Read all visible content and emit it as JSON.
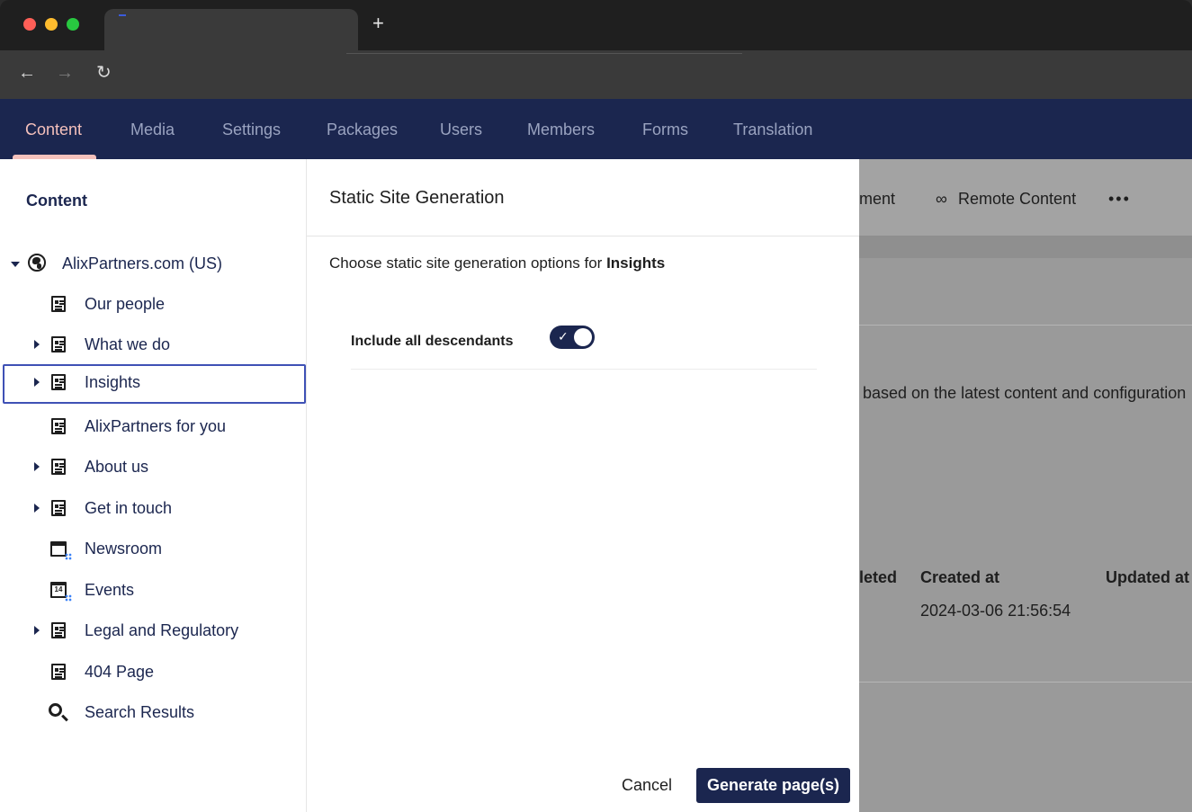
{
  "app": {
    "nav_tabs": [
      "Content",
      "Media",
      "Settings",
      "Packages",
      "Users",
      "Members",
      "Forms",
      "Translation"
    ],
    "active_tab": "Content"
  },
  "browser": {
    "new_tab": "+",
    "back": "←",
    "forward": "→",
    "reload": "↻"
  },
  "sidebar": {
    "title": "Content",
    "tree": [
      {
        "label": "AlixPartners.com (US)",
        "icon": "globe-icon",
        "expanded": true
      },
      {
        "label": "Our people",
        "icon": "document-icon"
      },
      {
        "label": "What we do",
        "icon": "document-icon",
        "has_children": true
      },
      {
        "label": "Insights",
        "icon": "document-icon",
        "has_children": true,
        "selected": true
      },
      {
        "label": "AlixPartners for you",
        "icon": "document-icon"
      },
      {
        "label": "About us",
        "icon": "document-icon",
        "has_children": true
      },
      {
        "label": "Get in touch",
        "icon": "document-icon",
        "has_children": true
      },
      {
        "label": "Newsroom",
        "icon": "newsroom-icon"
      },
      {
        "label": "Events",
        "icon": "calendar-icon",
        "calendar_day": "14"
      },
      {
        "label": "Legal and Regulatory",
        "icon": "document-icon",
        "has_children": true
      },
      {
        "label": "404 Page",
        "icon": "document-icon"
      },
      {
        "label": "Search Results",
        "icon": "search-icon"
      }
    ]
  },
  "background": {
    "tab_partial": "ment",
    "remote_content": "Remote Content",
    "infinity_symbol": "∞",
    "more": "•••",
    "description_partial": "based on the latest content and configuration",
    "table_headers": [
      "leted",
      "Created at",
      "Updated at"
    ],
    "created_at_value": "2024-03-06 21:56:54"
  },
  "modal": {
    "title": "Static Site Generation",
    "intro_prefix": "Choose static site generation options for ",
    "intro_target": "Insights",
    "option_label": "Include all descendants",
    "option_enabled": true,
    "toggle_check": "✓",
    "cancel_label": "Cancel",
    "generate_label": "Generate page(s)"
  },
  "colors": {
    "header_bg": "#1b264f",
    "active_tab": "#f5c1bc",
    "primary_button": "#1b264f",
    "selection_border": "#3f51b5"
  }
}
